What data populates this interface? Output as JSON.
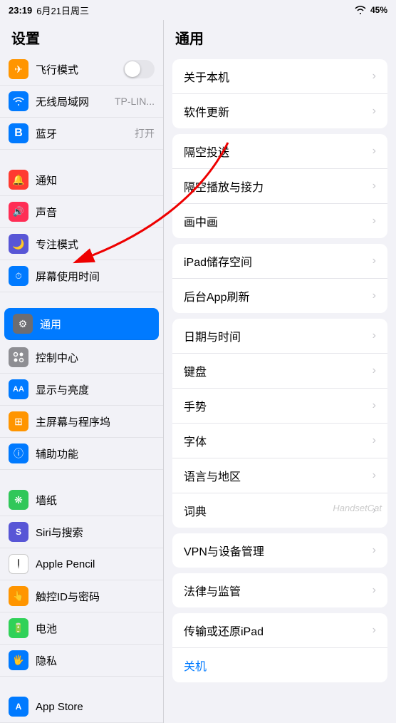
{
  "statusBar": {
    "time": "23:19",
    "date": "6月21日周三",
    "wifi": "WiFi",
    "battery": "45%"
  },
  "sidebar": {
    "title": "设置",
    "items": [
      {
        "id": "airplane",
        "label": "飞行模式",
        "sublabel": "",
        "toggle": true,
        "icon": "✈",
        "iconClass": "icon-airplane"
      },
      {
        "id": "wifi",
        "label": "无线局域网",
        "sublabel": "TP-LIN...",
        "icon": "wifi",
        "iconClass": "icon-wifi"
      },
      {
        "id": "bluetooth",
        "label": "蓝牙",
        "sublabel": "打开",
        "icon": "bt",
        "iconClass": "icon-bluetooth"
      },
      {
        "id": "notification",
        "label": "通知",
        "icon": "🔔",
        "iconClass": "icon-notification"
      },
      {
        "id": "sound",
        "label": "声音",
        "icon": "🔊",
        "iconClass": "icon-sound"
      },
      {
        "id": "focus",
        "label": "专注模式",
        "icon": "🌙",
        "iconClass": "icon-focus"
      },
      {
        "id": "screentime",
        "label": "屏幕使用时间",
        "icon": "⏱",
        "iconClass": "icon-screentime"
      },
      {
        "id": "general",
        "label": "通用",
        "icon": "⚙",
        "iconClass": "icon-general",
        "active": true
      },
      {
        "id": "controlcenter",
        "label": "控制中心",
        "icon": "🎛",
        "iconClass": "icon-controlcenter"
      },
      {
        "id": "display",
        "label": "显示与亮度",
        "icon": "AA",
        "iconClass": "icon-display"
      },
      {
        "id": "homescreen",
        "label": "主屏幕与程序坞",
        "icon": "⊞",
        "iconClass": "icon-homescreen"
      },
      {
        "id": "accessibility",
        "label": "辅助功能",
        "icon": "ⓘ",
        "iconClass": "icon-accessibility"
      },
      {
        "id": "wallpaper",
        "label": "墙纸",
        "icon": "❋",
        "iconClass": "icon-wallpaper"
      },
      {
        "id": "siri",
        "label": "Siri与搜索",
        "icon": "S",
        "iconClass": "icon-siri"
      },
      {
        "id": "applepencil",
        "label": "Apple Pencil",
        "icon": "✏",
        "iconClass": "icon-applepencil"
      },
      {
        "id": "touchid",
        "label": "触控ID与密码",
        "icon": "👆",
        "iconClass": "icon-touchid"
      },
      {
        "id": "battery",
        "label": "电池",
        "icon": "🔋",
        "iconClass": "icon-battery"
      },
      {
        "id": "privacy",
        "label": "隐私",
        "icon": "🖐",
        "iconClass": "icon-privacy"
      },
      {
        "id": "appstore",
        "label": "App Store",
        "icon": "A",
        "iconClass": "icon-appstore"
      }
    ]
  },
  "content": {
    "title": "通用",
    "sections": [
      {
        "items": [
          {
            "id": "about",
            "label": "关于本机"
          },
          {
            "id": "softwareupdate",
            "label": "软件更新"
          }
        ]
      },
      {
        "items": [
          {
            "id": "airdrop",
            "label": "隔空投送"
          },
          {
            "id": "airplay",
            "label": "隔空播放与接力"
          },
          {
            "id": "pip",
            "label": "画中画"
          }
        ]
      },
      {
        "items": [
          {
            "id": "ipad-storage",
            "label": "iPad储存空间"
          },
          {
            "id": "background-refresh",
            "label": "后台App刷新"
          }
        ]
      },
      {
        "items": [
          {
            "id": "datetime",
            "label": "日期与时间"
          },
          {
            "id": "keyboard",
            "label": "键盘"
          },
          {
            "id": "gestures",
            "label": "手势"
          },
          {
            "id": "fonts",
            "label": "字体"
          },
          {
            "id": "language",
            "label": "语言与地区"
          },
          {
            "id": "dictionary",
            "label": "词典"
          }
        ]
      },
      {
        "items": [
          {
            "id": "vpn",
            "label": "VPN与设备管理"
          }
        ]
      },
      {
        "items": [
          {
            "id": "legal",
            "label": "法律与监管"
          }
        ]
      },
      {
        "items": [
          {
            "id": "transfer",
            "label": "传输或还原iPad"
          },
          {
            "id": "shutdown",
            "label": "关机",
            "blue": true
          }
        ]
      }
    ]
  },
  "arrow": {
    "annotation": "red arrow pointing to 通用"
  }
}
